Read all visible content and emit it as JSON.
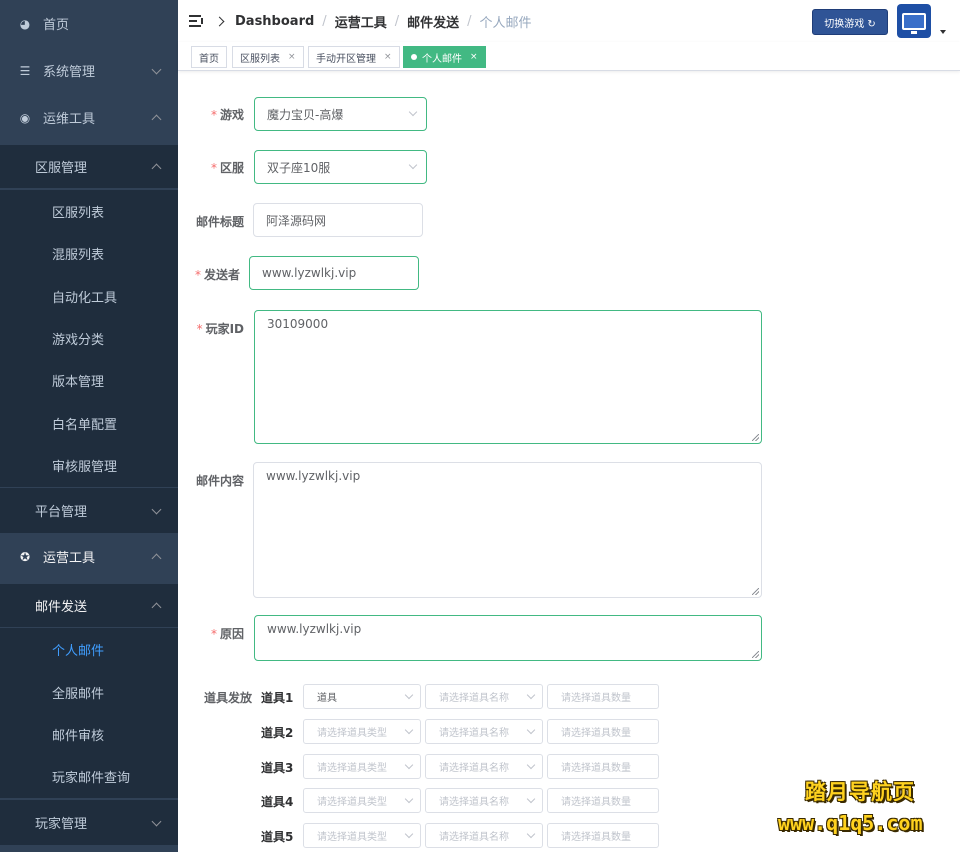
{
  "sidebar": {
    "home": "首页",
    "system": "系统管理",
    "ops": "运维工具",
    "zone_mgmt": "区服管理",
    "zone_items": [
      "区服列表",
      "混服列表",
      "自动化工具",
      "游戏分类",
      "版本管理",
      "白名单配置",
      "审核服管理"
    ],
    "platform": "平台管理",
    "operation": "运营工具",
    "mail_send": "邮件发送",
    "mail_items": [
      "个人邮件",
      "全服邮件",
      "邮件审核",
      "玩家邮件查询"
    ],
    "player_mgmt": "玩家管理"
  },
  "breadcrumb": [
    "Dashboard",
    "运营工具",
    "邮件发送",
    "个人邮件"
  ],
  "header": {
    "switch_game": "切换游戏 ↻"
  },
  "tags": [
    {
      "label": "首页",
      "closable": false
    },
    {
      "label": "区服列表",
      "closable": true
    },
    {
      "label": "手动开区管理",
      "closable": true
    },
    {
      "label": "个人邮件",
      "closable": true,
      "active": true
    }
  ],
  "form": {
    "game": {
      "label": "游戏",
      "value": "魔力宝贝-高爆"
    },
    "zone": {
      "label": "区服",
      "value": "双子座10服"
    },
    "title": {
      "label": "邮件标题",
      "value": "阿泽源码网"
    },
    "sender": {
      "label": "发送者",
      "value": "www.lyzwlkj.vip"
    },
    "player_id": {
      "label": "玩家ID",
      "value": "30109000"
    },
    "content": {
      "label": "邮件内容",
      "value": "www.lyzwlkj.vip"
    },
    "reason": {
      "label": "原因",
      "value": "www.lyzwlkj.vip"
    },
    "items_label": "道具发放",
    "items": [
      {
        "label": "道具1",
        "type": "道具",
        "name_ph": "请选择道具名称",
        "qty_ph": "请选择道具数量"
      },
      {
        "label": "道具2",
        "type": "请选择道具类型",
        "name_ph": "请选择道具名称",
        "qty_ph": "请选择道具数量"
      },
      {
        "label": "道具3",
        "type": "请选择道具类型",
        "name_ph": "请选择道具名称",
        "qty_ph": "请选择道具数量"
      },
      {
        "label": "道具4",
        "type": "请选择道具类型",
        "name_ph": "请选择道具名称",
        "qty_ph": "请选择道具数量"
      },
      {
        "label": "道具5",
        "type": "请选择道具类型",
        "name_ph": "请选择道具名称",
        "qty_ph": "请选择道具数量"
      }
    ]
  },
  "watermark": {
    "line1": "踏月导航页",
    "line2": "www.q1q5.com"
  },
  "colors": {
    "sidebar_bg": "#304156",
    "submenu_bg": "#1f2d3d",
    "accent": "#42b983",
    "active_link": "#409eff"
  }
}
